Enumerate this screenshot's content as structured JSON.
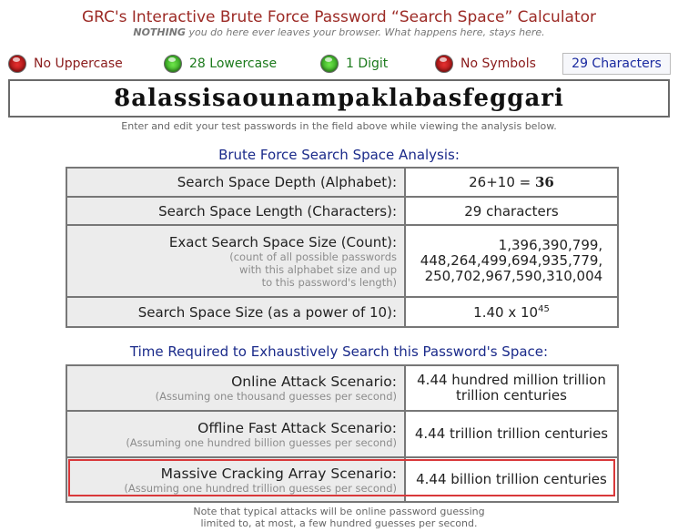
{
  "header": {
    "title": "GRC's Interactive Brute Force Password “Search Space” Calculator",
    "subtitle_bold": "NOTHING",
    "subtitle_rest": " you do here ever leaves your browser. What happens here, stays here."
  },
  "indicators": [
    {
      "label": "No Uppercase",
      "status": "red"
    },
    {
      "label": "28 Lowercase",
      "status": "green"
    },
    {
      "label": "1 Digit",
      "status": "green"
    },
    {
      "label": "No Symbols",
      "status": "red"
    }
  ],
  "char_count": "29 Characters",
  "password": "8alassisaounampaklabasfeggari",
  "hint": "Enter and edit your test passwords in the field above while viewing the analysis below.",
  "analysis": {
    "heading": "Brute Force Search Space Analysis:",
    "depth_label": "Search Space Depth (Alphabet):",
    "depth_value_prefix": "26+10 = ",
    "depth_value_total": "36",
    "length_label": "Search Space Length (Characters):",
    "length_value": "29 characters",
    "exact_label": "Exact Search Space Size (Count):",
    "exact_sub1": "(count of all possible passwords",
    "exact_sub2": "with this alphabet size and up",
    "exact_sub3": "to this password's length)",
    "exact_value1": "1,396,390,799,",
    "exact_value2": "448,264,499,694,935,779,",
    "exact_value3": "250,702,967,590,310,004",
    "power_label": "Search Space Size (as a power of 10):",
    "power_value_base": "1.40 x 10",
    "power_value_exp": "45"
  },
  "time": {
    "heading": "Time Required to Exhaustively Search this Password's Space:",
    "rows": [
      {
        "label": "Online Attack Scenario:",
        "sub": "(Assuming one thousand guesses per second)",
        "value": "4.44 hundred million trillion trillion centuries"
      },
      {
        "label": "Offline Fast Attack Scenario:",
        "sub": "(Assuming one hundred billion guesses per second)",
        "value": "4.44 trillion trillion centuries"
      },
      {
        "label": "Massive Cracking Array Scenario:",
        "sub": "(Assuming one hundred trillion guesses per second)",
        "value": "4.44 billion trillion centuries"
      }
    ]
  },
  "footer": {
    "line1": "Note that typical attacks will be online password guessing",
    "line2": "limited to, at most, a few hundred guesses per second."
  },
  "colors": {
    "title": "#9c2a25",
    "section": "#1a2a8a",
    "highlight": "#d9383a",
    "led_red": "#c81e1e",
    "led_green": "#3cbc2a"
  }
}
